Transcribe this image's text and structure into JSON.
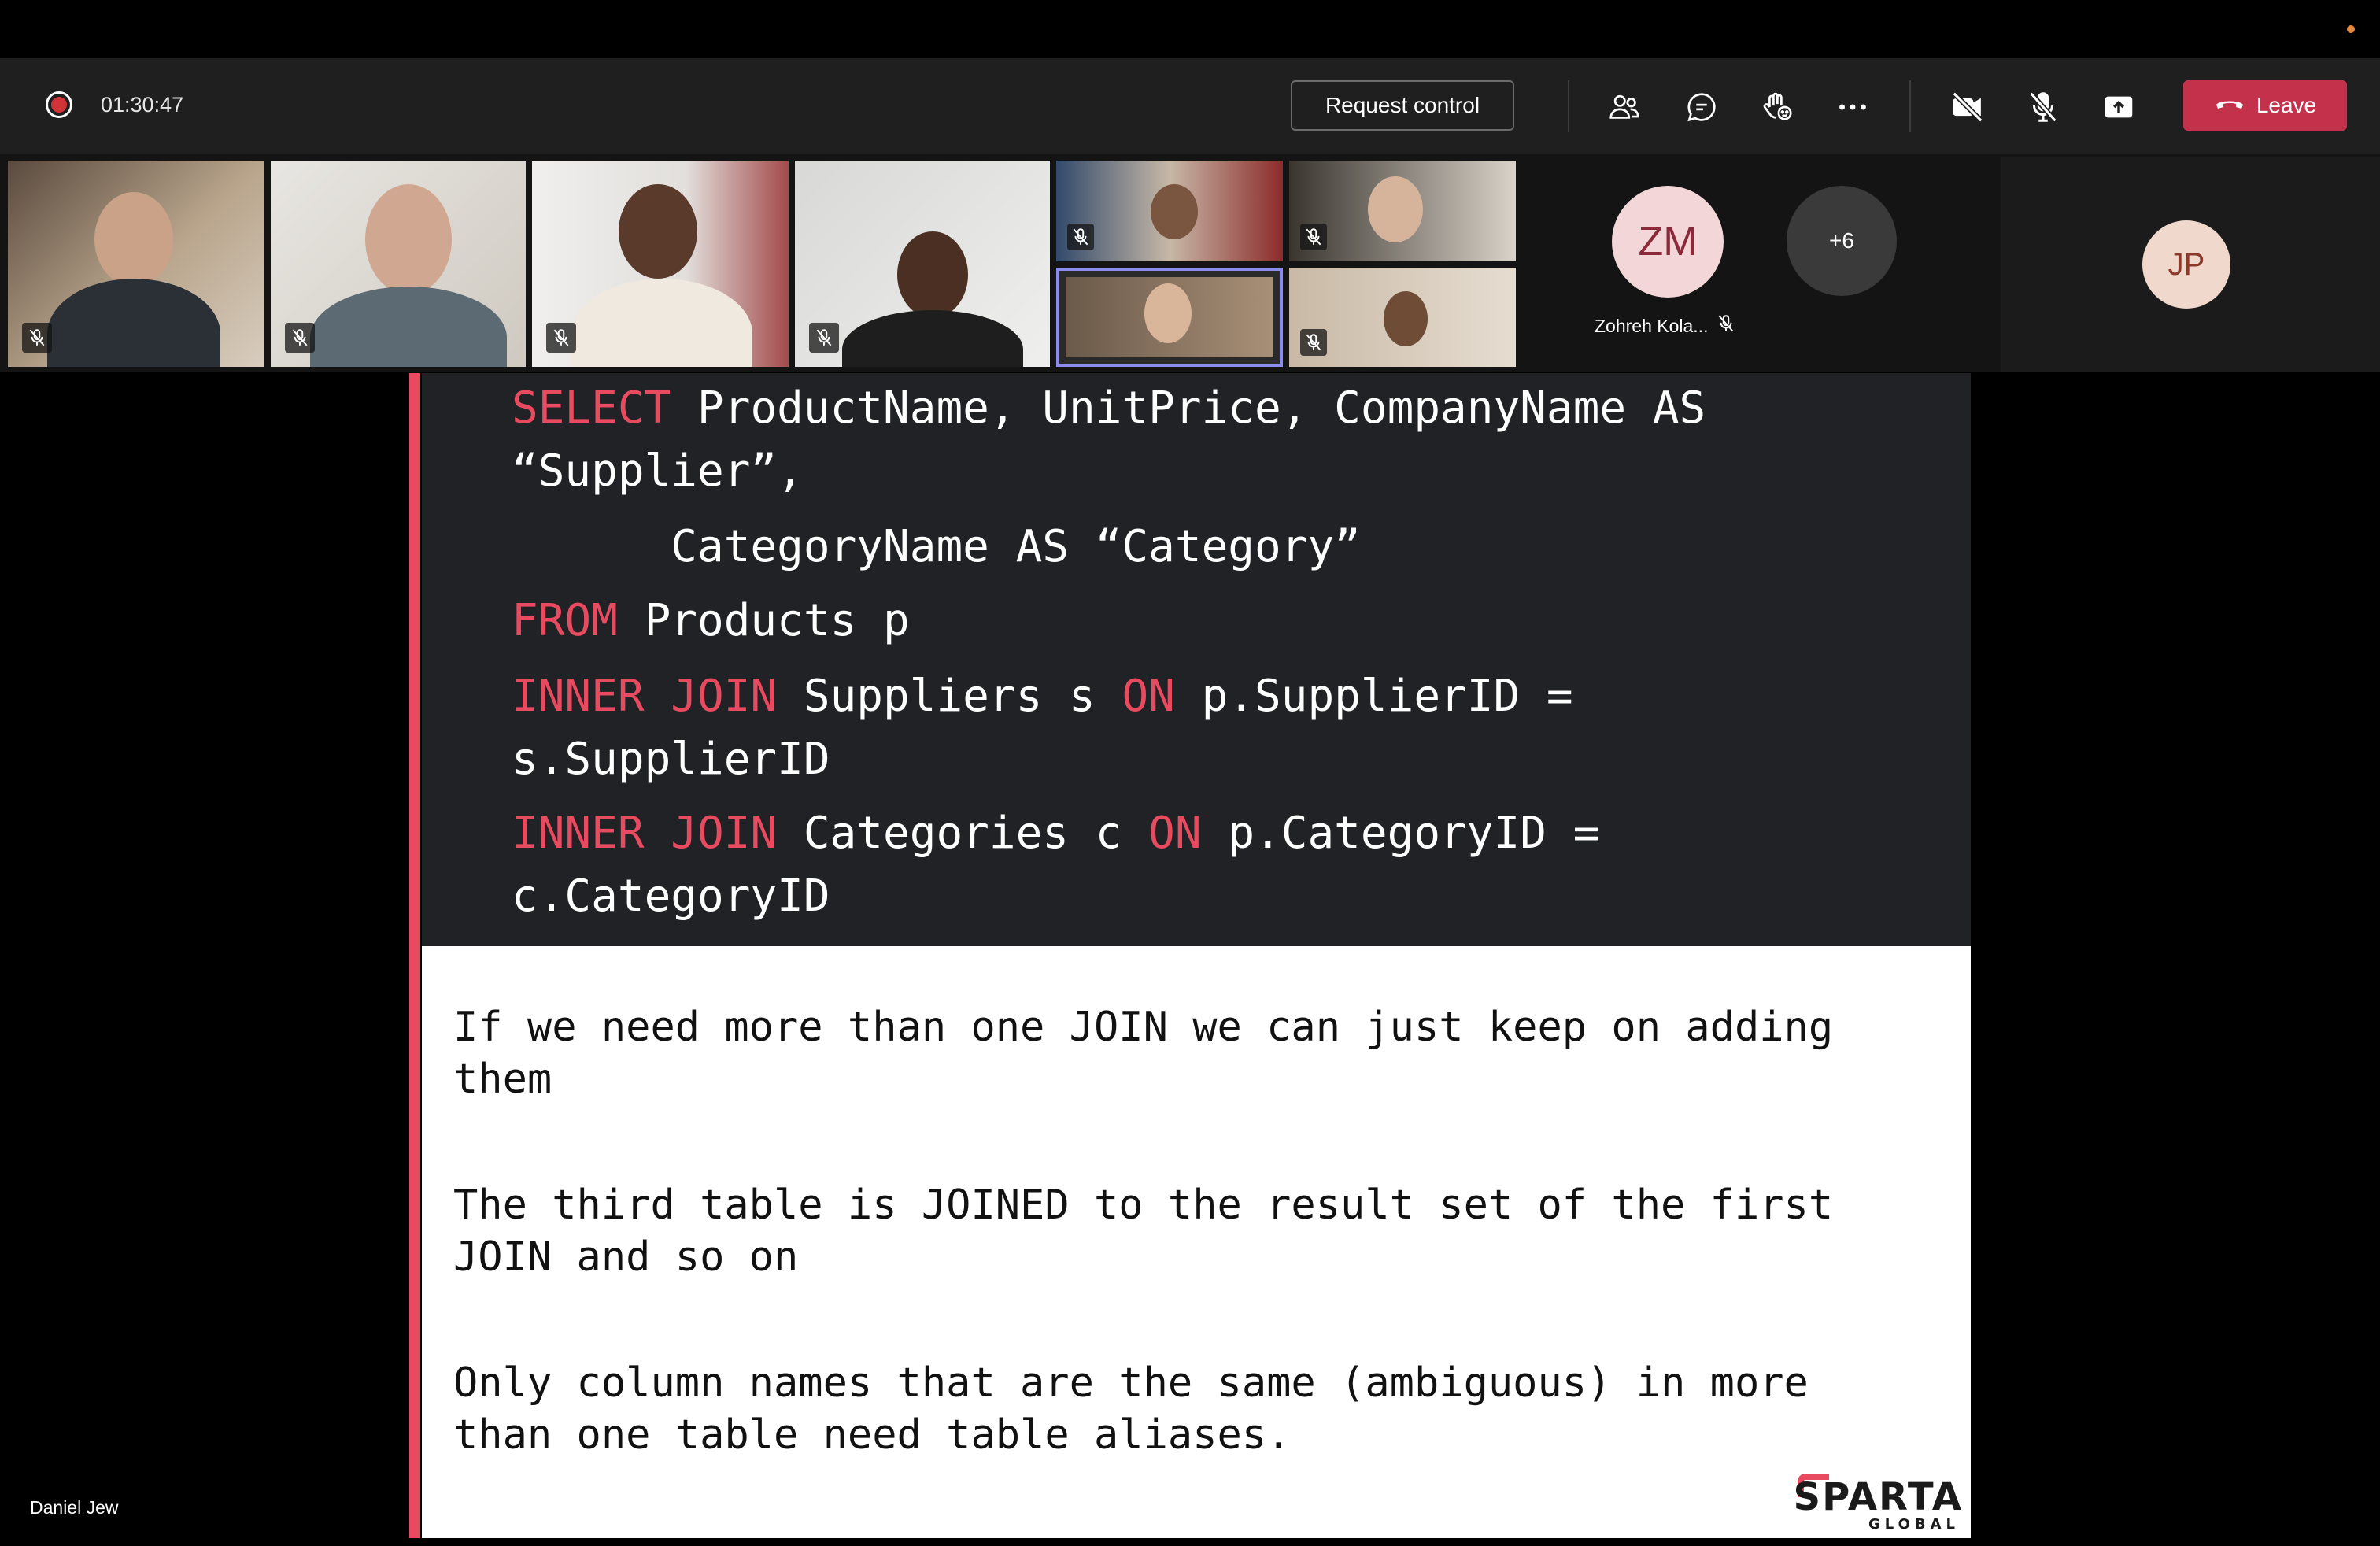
{
  "call": {
    "timer": "01:30:47",
    "request_control_label": "Request control",
    "leave_label": "Leave"
  },
  "toolbar_icons": [
    "participants-icon",
    "chat-icon",
    "raise-hand-icon",
    "more-options-icon",
    "camera-off-icon",
    "mic-off-icon",
    "share-screen-icon"
  ],
  "gallery": {
    "zm": {
      "initials": "ZM",
      "name": "Zohreh Kola..."
    },
    "overflow_count": "+6",
    "jp": {
      "initials": "JP"
    }
  },
  "presenter_name": "Daniel Jew",
  "slide": {
    "code_lines": [
      {
        "parts": [
          [
            "kw",
            "SELECT"
          ],
          [
            "t",
            " ProductName, UnitPrice, CompanyName AS"
          ]
        ]
      },
      {
        "parts": [
          [
            "t",
            "“Supplier”,"
          ]
        ]
      },
      {
        "parts": [
          [
            "t",
            "      CategoryName AS “Category”"
          ]
        ]
      },
      {
        "parts": [
          [
            "kw",
            "FROM"
          ],
          [
            "t",
            " Products p"
          ]
        ]
      },
      {
        "parts": [
          [
            "kw",
            "INNER JOIN"
          ],
          [
            "t",
            " Suppliers s "
          ],
          [
            "kw",
            "ON"
          ],
          [
            "t",
            " p.SupplierID ="
          ]
        ]
      },
      {
        "parts": [
          [
            "t",
            "s.SupplierID"
          ]
        ]
      },
      {
        "parts": [
          [
            "kw",
            "INNER JOIN"
          ],
          [
            "t",
            " Categories c "
          ],
          [
            "kw",
            "ON"
          ],
          [
            "t",
            " p.CategoryID ="
          ]
        ]
      },
      {
        "parts": [
          [
            "t",
            "c.CategoryID"
          ]
        ]
      }
    ],
    "paragraphs": [
      "If we need more than one JOIN we can just keep on adding them",
      "The third table is JOINED to the result set of the first JOIN and so on",
      "Only column names that are the same (ambiguous) in more than one table need table aliases."
    ],
    "logo_word": "SPARTA",
    "logo_sub": "GLOBAL"
  },
  "colors": {
    "accent_red": "#e84a5f",
    "leave_red": "#c4314b",
    "toolbar_bg": "#1f1f1f",
    "code_bg": "#202226"
  }
}
